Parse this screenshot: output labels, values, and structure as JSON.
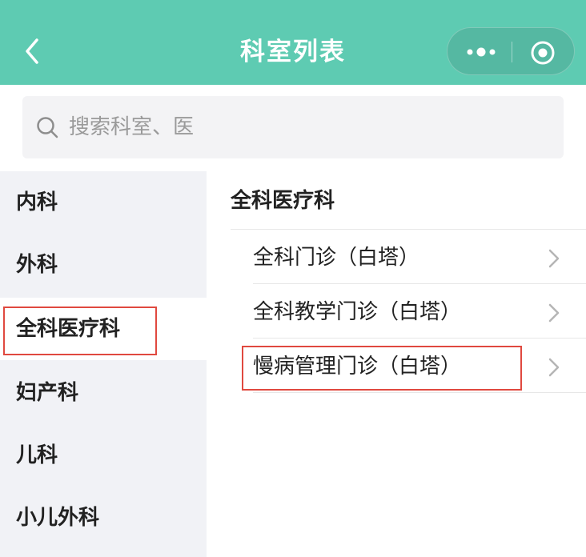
{
  "header": {
    "title": "科室列表",
    "back_icon": "chevron-left-icon",
    "capsule": {
      "more_icon": "more-dots-icon",
      "close_icon": "target-circle-icon"
    }
  },
  "search": {
    "placeholder": "搜索科室、医"
  },
  "sidebar": {
    "items": [
      {
        "label": "内科"
      },
      {
        "label": "外科"
      },
      {
        "label": "全科医疗科",
        "active": true
      },
      {
        "label": "妇产科"
      },
      {
        "label": "儿科"
      },
      {
        "label": "小儿外科"
      }
    ]
  },
  "content": {
    "section_title": "全科医疗科",
    "clinics": [
      {
        "name": "全科门诊（白塔）"
      },
      {
        "name": "全科教学门诊（白塔）"
      },
      {
        "name": "慢病管理门诊（白塔）"
      }
    ]
  },
  "colors": {
    "header_bg": "#5ecbb2",
    "sidebar_bg": "#f1f2f6",
    "highlight": "#e0493f"
  }
}
